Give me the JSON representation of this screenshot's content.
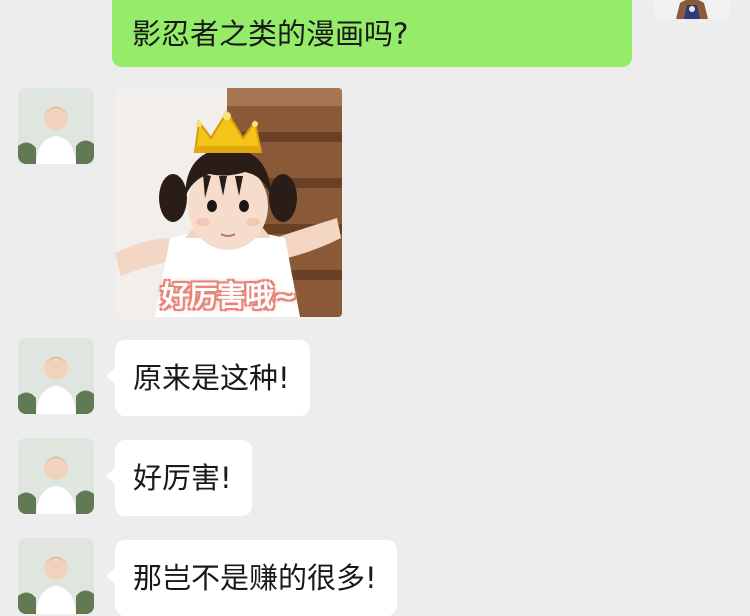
{
  "chat": {
    "messages": [
      {
        "side": "out",
        "text": "影忍者之类的漫画吗?"
      },
      {
        "side": "in",
        "type": "sticker",
        "caption": "好厉害哦~"
      },
      {
        "side": "in",
        "text": "原来是这种!"
      },
      {
        "side": "in",
        "text": "好厉害!"
      },
      {
        "side": "in",
        "text": "那岂不是赚的很多!"
      }
    ]
  },
  "colors": {
    "background": "#ededed",
    "outgoing_bubble": "#95ec69",
    "incoming_bubble": "#ffffff"
  }
}
